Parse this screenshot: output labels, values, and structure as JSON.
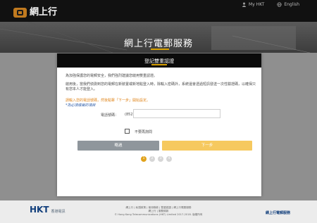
{
  "header": {
    "logo_text": "網上行",
    "links": [
      {
        "label": "My HKT",
        "icon": "user-icon"
      },
      {
        "label": "English",
        "icon": "globe-icon"
      }
    ]
  },
  "hero": {
    "title": "網上行電郵服務"
  },
  "modal": {
    "title": "登記雙重認證",
    "paragraph1": "為加強保護您的電郵安全，我們強烈建議您啟用雙重認證。",
    "paragraph2": "啟用後，當我們偵測到您的電郵在新裝置或新地點登入時，除輸入密碼外，系統還會透過短訊發送一次性驗證碼，以確保只有您本人才能登入。",
    "instruction": "請輸入您的電話號碼，然後點擊「下一步」開始設定。",
    "required_note": "*為必須填寫的項目",
    "phone_label": "電話號碼：",
    "phone_prefix": "(852)",
    "phone_value": "",
    "checkbox_label": "不要再詢問",
    "skip_button": "略過",
    "next_button": "下一步",
    "steps": [
      "1",
      "2",
      "3",
      "4"
    ],
    "active_step": 1
  },
  "footer": {
    "brand": "HKT",
    "brand_sub": "香港電訊",
    "links_line1": "網上行 | 私隱政策 | 使用條款 | 雙重認證 | 網上行電郵服務",
    "links_line2": "網上行 | 服務條款",
    "copyright": "© Hong Kong Telecommunications (HKT) Limited 2017-2018. 版權所有",
    "right_text": "網上行電郵服務"
  },
  "colors": {
    "accent": "#d8a000",
    "next_button": "#f6c95f",
    "skip_button": "#8f969c",
    "brand_blue": "#113e7b"
  }
}
